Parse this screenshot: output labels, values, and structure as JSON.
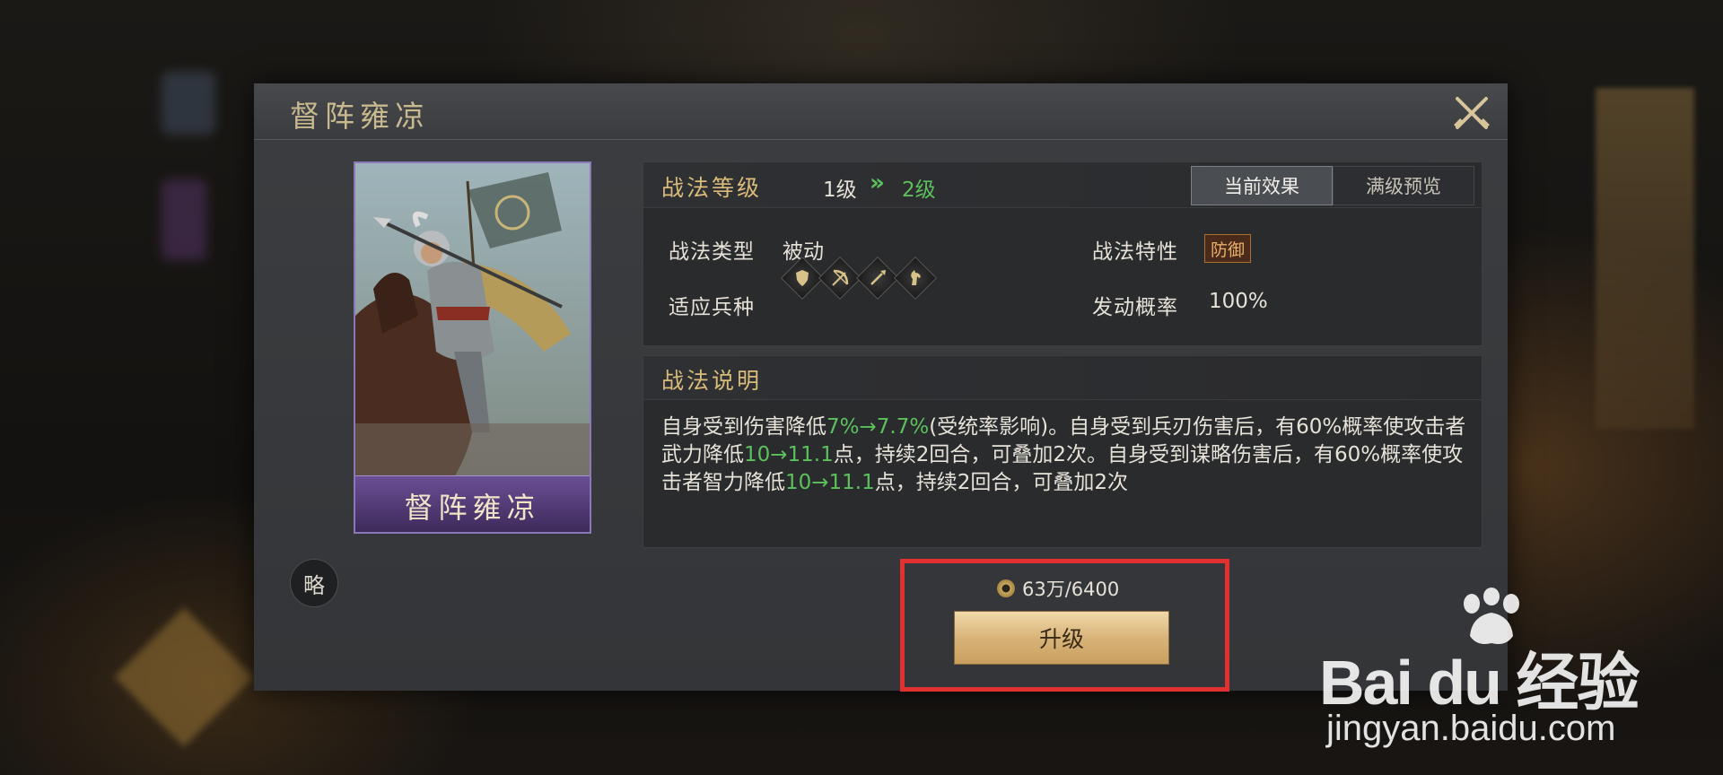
{
  "dialog": {
    "title": "督阵雍凉",
    "card_name": "督阵雍凉",
    "brief_label": "略"
  },
  "level": {
    "title": "战法等级",
    "from": "1级",
    "arrow": "»",
    "to": "2级",
    "tabs": [
      {
        "label": "当前效果",
        "active": true
      },
      {
        "label": "满级预览",
        "active": false
      }
    ]
  },
  "attributes": {
    "type_label": "战法类型",
    "type_value": "被动",
    "trait_label": "战法特性",
    "trait_value": "防御",
    "troops_label": "适应兵种",
    "troops": [
      "shield-icon",
      "bow-icon",
      "spear-icon",
      "horse-icon"
    ],
    "rate_label": "发动概率",
    "rate_value": "100%"
  },
  "description": {
    "title": "战法说明",
    "segments": [
      {
        "text": "自身受到伤害降低",
        "hl": false
      },
      {
        "text": "7%→7.7%",
        "hl": true
      },
      {
        "text": "(受统率影响)。自身受到兵刃伤害后，有60%概率使攻击者武力降低",
        "hl": false
      },
      {
        "text": "10→11.1",
        "hl": true
      },
      {
        "text": "点，持续2回合，可叠加2次。自身受到谋略伤害后，有60%概率使攻击者智力降低",
        "hl": false
      },
      {
        "text": "10→11.1",
        "hl": true
      },
      {
        "text": "点，持续2回合，可叠加2次",
        "hl": false
      }
    ]
  },
  "upgrade": {
    "cost": "63万/6400",
    "button_label": "升级"
  },
  "watermark": {
    "brand": "Bai du 经验",
    "url": "jingyan.baidu.com"
  },
  "colors": {
    "highlight_green": "#5cc15c",
    "title_gold": "#d9bb7a",
    "annotation_red": "#e03030"
  }
}
